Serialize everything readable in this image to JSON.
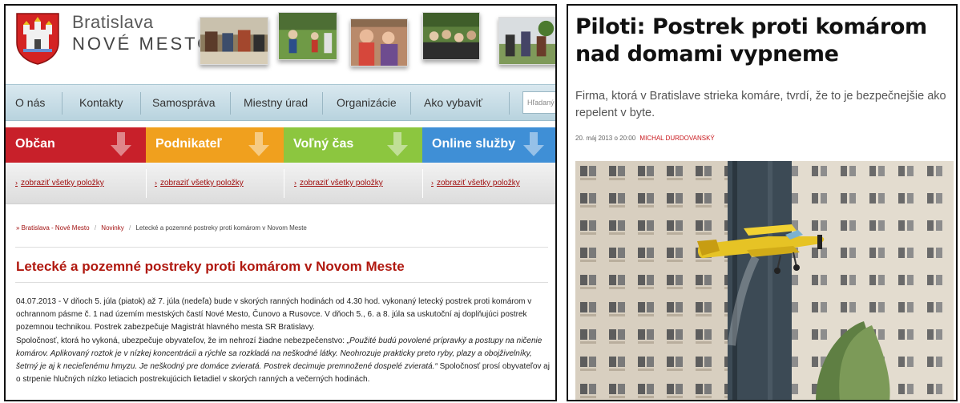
{
  "left": {
    "header": {
      "town_line1": "Bratislava",
      "town_line2": "NOVÉ MESTO"
    },
    "nav": {
      "items": [
        "O nás",
        "Kontakty",
        "Samospráva",
        "Miestny úrad",
        "Organizácie",
        "Ako vybaviť"
      ],
      "search_placeholder": "Hľadaný"
    },
    "categories": [
      {
        "label": "Občan",
        "color": "#c8202a"
      },
      {
        "label": "Podnikateľ",
        "color": "#f0a01e"
      },
      {
        "label": "Voľný čas",
        "color": "#8cc63f"
      },
      {
        "label": "Online služby",
        "color": "#3f8fd6"
      }
    ],
    "sublinks": [
      "zobraziť všetky položky",
      "zobraziť všetky položky",
      "zobraziť všetky položky",
      "zobraziť všetky položky"
    ],
    "breadcrumb": {
      "home": "» Bratislava - Nové Mesto",
      "section": "Novinky",
      "current": "Letecké a pozemné postreky proti komárom v Novom Meste",
      "sep": "/"
    },
    "article": {
      "title": "Letecké a pozemné postreky proti komárom v Novom Meste",
      "p1": "04.07.2013 - V dňoch 5. júla (piatok) až 7. júla (nedeľa) bude v skorých ranných hodinách od 4.30 hod. vykonaný letecký postrek proti komárom v ochrannom pásme č. 1 nad územím mestských častí Nové Mesto, Čunovo a Rusovce. V dňoch 5., 6. a 8. júla sa uskutoční aj doplňujúci postrek pozemnou technikou. Postrek zabezpečuje Magistrát hlavného mesta SR Bratislavy.",
      "p2_start": "Spoločnosť, ktorá ho vykoná, ubezpečuje obyvateľov, že im nehrozí žiadne nebezpečenstvo: ",
      "p2_quote": "„Použité budú povolené prípravky a postupy na ničenie komárov. Aplikovaný roztok je v nízkej koncentrácii a rýchle sa rozkladá na neškodné látky. Neohrozuje prakticky preto ryby, plazy a obojživelníky, šetrný je aj k necieľenému hmyzu. Je neškodný pre domáce zvieratá. Postrek decimuje premnožené dospelé zvieratá.“",
      "p2_end": " Spoločnosť prosí obyvateľov aj o strpenie hlučných nízko letiacich postrekujúcich lietadiel v skorých ranných a večerných hodinách."
    }
  },
  "right": {
    "headline": "Piloti: Postrek proti komárom nad domami vypneme",
    "perex": "Firma, ktorá v Bratislave strieka komáre, tvrdí, že to je bezpečnejšie ako repelent v byte.",
    "date": "20. máj 2013 o 20:00",
    "author": "MICHAL DURDOVANSKÝ"
  },
  "colors": {
    "accent_red": "#b0180f",
    "nav_blue": "#c6dde7",
    "author_red": "#c8171c"
  }
}
